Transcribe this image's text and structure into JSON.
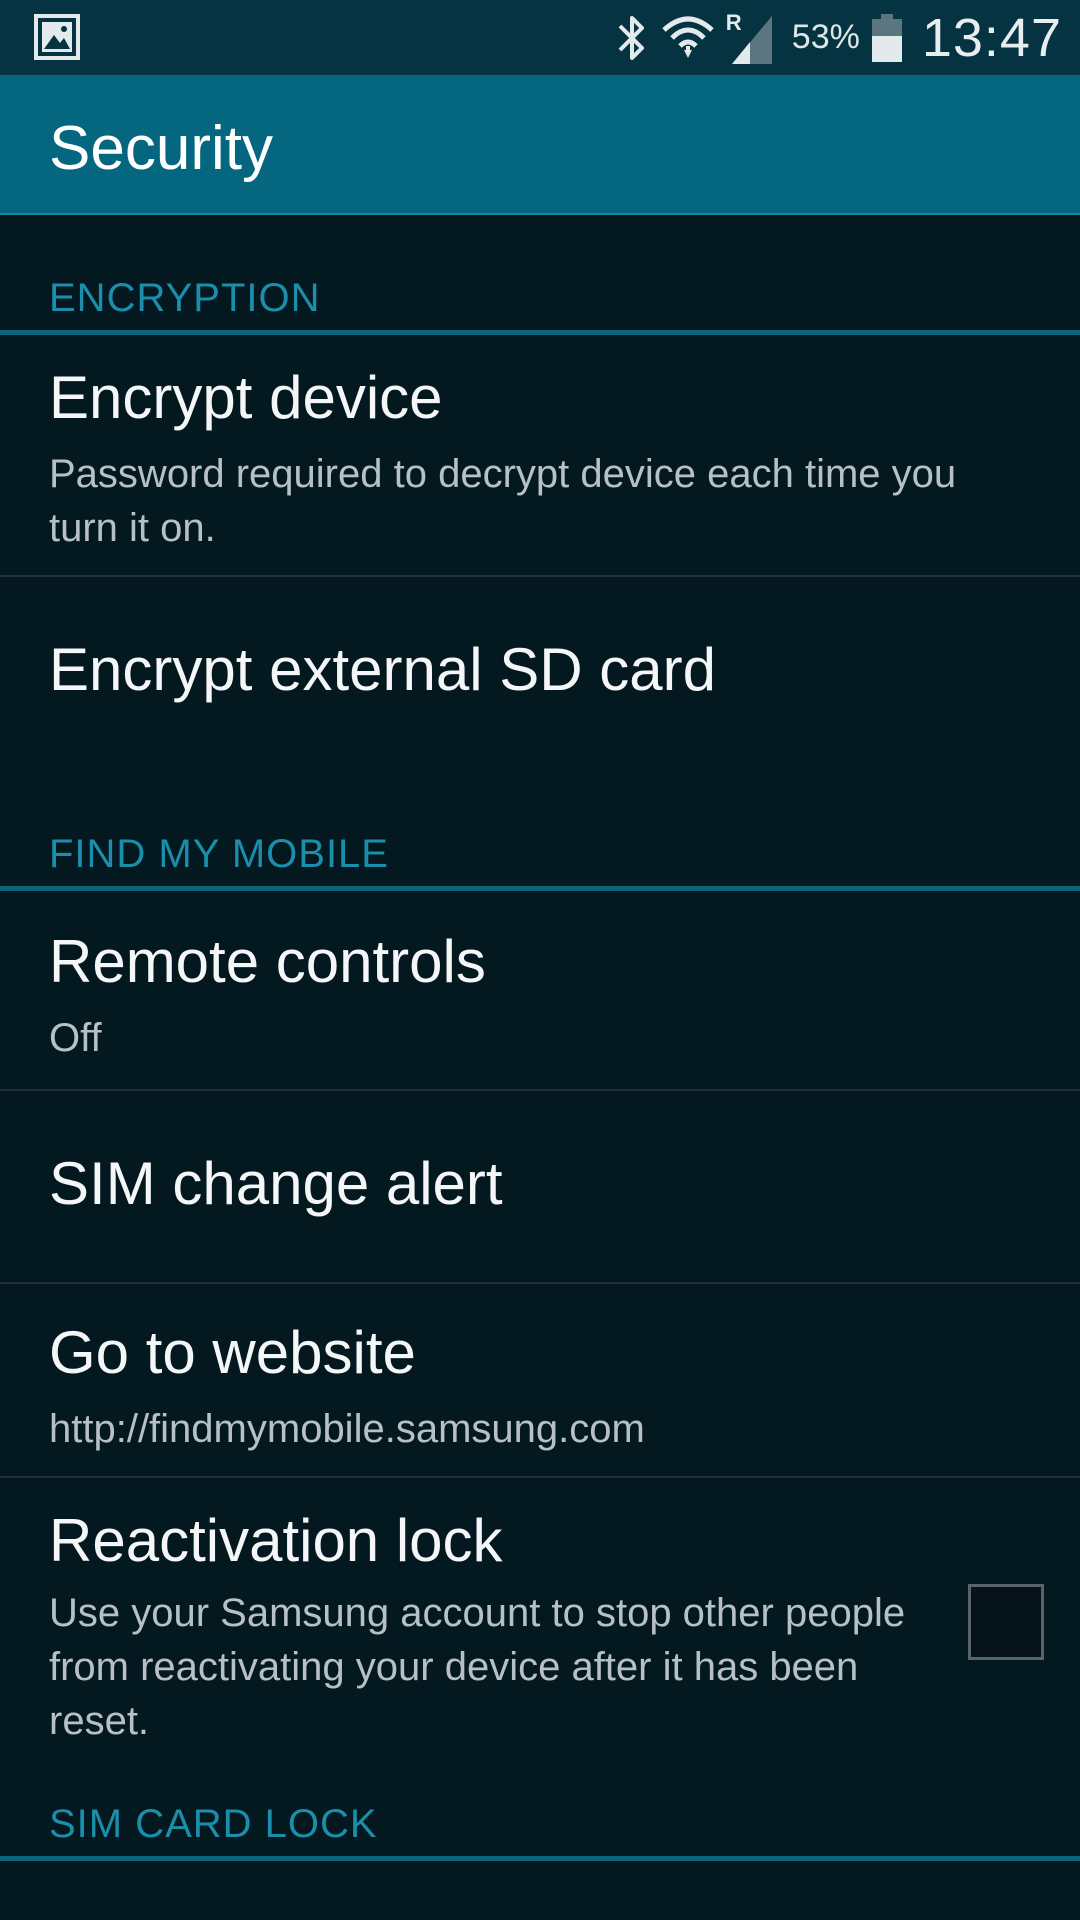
{
  "status_bar": {
    "battery_percent": "53%",
    "time": "13:47",
    "roaming_indicator": "R",
    "icons": [
      "gallery-icon",
      "bluetooth-icon",
      "wifi-icon",
      "signal-icon",
      "battery-icon"
    ]
  },
  "header": {
    "title": "Security"
  },
  "sections": {
    "encryption": {
      "label": "ENCRYPTION",
      "items": [
        {
          "title": "Encrypt device",
          "subtitle": "Password required to decrypt device each time you turn it on."
        },
        {
          "title": "Encrypt external SD card"
        }
      ]
    },
    "find_my_mobile": {
      "label": "FIND MY MOBILE",
      "items": [
        {
          "title": "Remote controls",
          "subtitle": "Off"
        },
        {
          "title": "SIM change alert"
        },
        {
          "title": "Go to website",
          "subtitle": "http://findmymobile.samsung.com"
        },
        {
          "title": "Reactivation lock",
          "subtitle": "Use your Samsung account to stop other people from reactivating your device after it has been reset.",
          "checked": false
        }
      ]
    },
    "sim_card_lock": {
      "label": "SIM CARD LOCK"
    }
  },
  "colors": {
    "status_bar": "#053341",
    "action_bar": "#04677f",
    "background": "#041820",
    "section_header": "#1a8eab"
  }
}
